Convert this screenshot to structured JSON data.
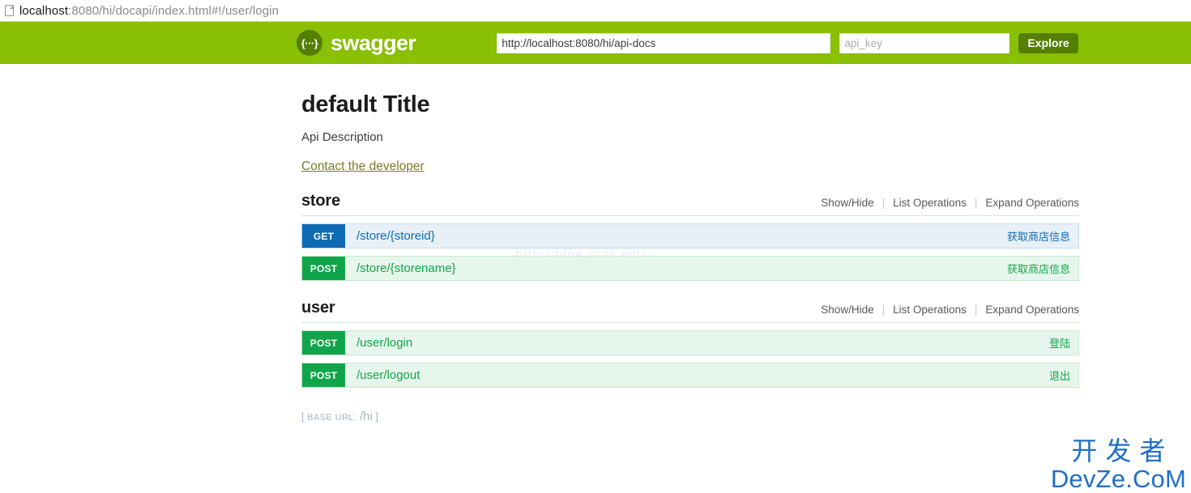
{
  "browser": {
    "page_icon": "page-icon",
    "url_host": "localhost",
    "url_rest": ":8080/hi/docapi/index.html#!/user/login"
  },
  "header": {
    "logo_glyph": "{···}",
    "brand": "swagger",
    "url_input_value": "http://localhost:8080/hi/api-docs",
    "api_key_placeholder": "api_key",
    "api_key_value": "",
    "explore_label": "Explore",
    "bg_color": "#89bf04",
    "accent_color": "#547f00"
  },
  "api": {
    "title": "default Title",
    "description": "Api Description",
    "contact_link": "Contact the developer",
    "base_url_label": "Base URL:",
    "base_url_value": "/hi",
    "base_url_open": "[",
    "base_url_close": "]"
  },
  "op_links": {
    "show_hide": "Show/Hide",
    "list_operations": "List Operations",
    "expand_operations": "Expand Operations"
  },
  "resources": [
    {
      "name": "store",
      "endpoints": [
        {
          "method": "GET",
          "path": "/store/{storeid}",
          "summary": "获取商店信息",
          "color": "#0f6ab4"
        },
        {
          "method": "POST",
          "path": "/store/{storename}",
          "summary": "获取商店信息",
          "color": "#10a54a"
        }
      ]
    },
    {
      "name": "user",
      "endpoints": [
        {
          "method": "POST",
          "path": "/user/login",
          "summary": "登陆",
          "color": "#10a54a"
        },
        {
          "method": "POST",
          "path": "/user/logout",
          "summary": "退出",
          "color": "#10a54a"
        }
      ]
    }
  ],
  "watermarks": {
    "blog_url": "http://blog.csdn.net/",
    "logo_cn": "开发者",
    "logo_en": "DevZe.CoM"
  }
}
